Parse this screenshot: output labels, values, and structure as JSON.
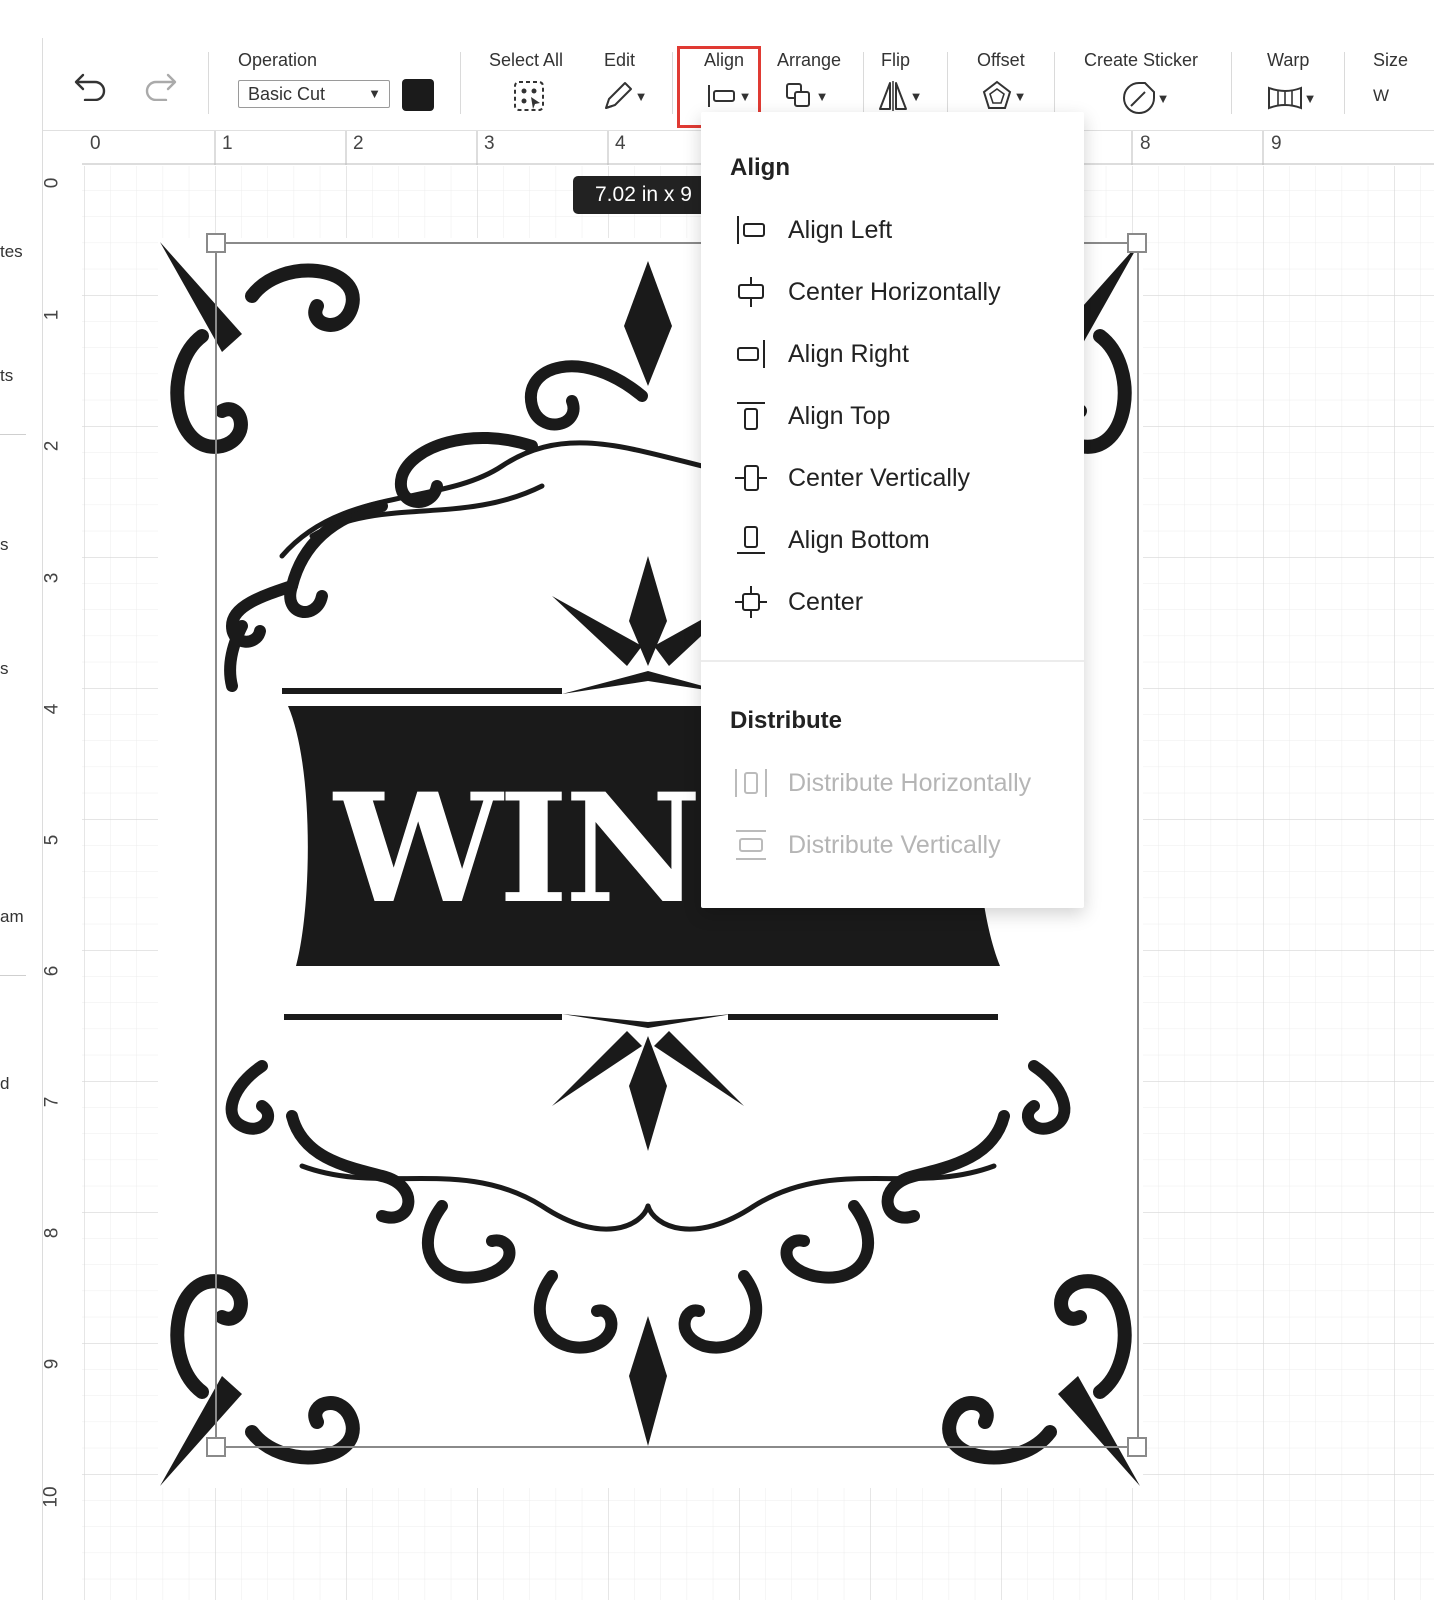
{
  "left_panel": {
    "labels": [
      "tes",
      "ts",
      "s",
      "s",
      "am",
      "d"
    ]
  },
  "toolbar": {
    "operation_label": "Operation",
    "operation_value": "Basic Cut",
    "select_all_label": "Select All",
    "edit_label": "Edit",
    "align_label": "Align",
    "arrange_label": "Arrange",
    "flip_label": "Flip",
    "offset_label": "Offset",
    "create_sticker_label": "Create Sticker",
    "warp_label": "Warp",
    "size_label": "Size",
    "size_w_label": "W",
    "highlight_color": "#e03a33",
    "swatch_color": "#1b1b1b"
  },
  "rulers": {
    "top": [
      "0",
      "1",
      "2",
      "3",
      "4",
      "8",
      "9"
    ],
    "left": [
      "0",
      "1",
      "2",
      "3",
      "4",
      "5",
      "6",
      "7",
      "8",
      "9",
      "10"
    ]
  },
  "canvas": {
    "dimension_badge": "7.02  in x 9",
    "design_text": "WINE"
  },
  "align_menu": {
    "align_heading": "Align",
    "items": [
      {
        "label": "Align Left",
        "icon": "align-left-icon",
        "enabled": true
      },
      {
        "label": "Center Horizontally",
        "icon": "center-horizontally-icon",
        "enabled": true
      },
      {
        "label": "Align Right",
        "icon": "align-right-icon",
        "enabled": true
      },
      {
        "label": "Align Top",
        "icon": "align-top-icon",
        "enabled": true
      },
      {
        "label": "Center Vertically",
        "icon": "center-vertically-icon",
        "enabled": true
      },
      {
        "label": "Align Bottom",
        "icon": "align-bottom-icon",
        "enabled": true
      },
      {
        "label": "Center",
        "icon": "center-icon",
        "enabled": true
      }
    ],
    "distribute_heading": "Distribute",
    "distribute_items": [
      {
        "label": "Distribute Horizontally",
        "icon": "distribute-horizontally-icon",
        "enabled": false
      },
      {
        "label": "Distribute Vertically",
        "icon": "distribute-vertically-icon",
        "enabled": false
      }
    ]
  }
}
